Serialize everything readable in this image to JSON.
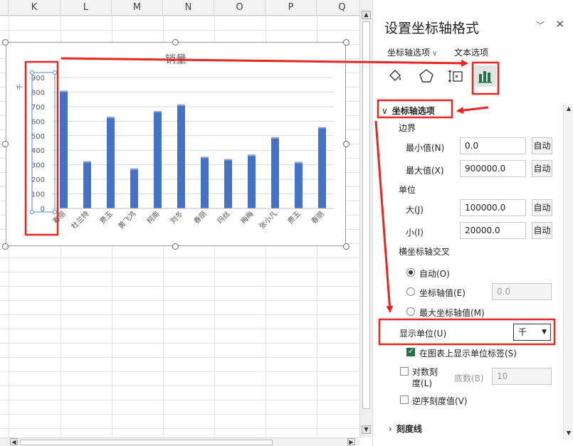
{
  "sheet": {
    "columns": [
      "K",
      "L",
      "M",
      "N",
      "O",
      "P",
      "Q"
    ]
  },
  "chart_data": {
    "type": "bar",
    "title": "销量",
    "categories": [
      "春丽",
      "杜兰特",
      "费玉",
      "黄飞鸿",
      "柯南",
      "刘冬",
      "春丽",
      "玛丝",
      "梅梅",
      "张小凡",
      "费玉",
      "春丽"
    ],
    "values": [
      810,
      325,
      630,
      275,
      670,
      715,
      355,
      340,
      370,
      490,
      320,
      560
    ],
    "yticks": [
      "900",
      "800",
      "700",
      "600",
      "500",
      "400",
      "300",
      "200",
      "100",
      "0"
    ],
    "ylim": [
      0,
      900
    ],
    "unit_label": "千",
    "grid": true,
    "color": "#4472c4"
  },
  "pane": {
    "title": "设置坐标轴格式",
    "tab_axis_options": "坐标轴选项",
    "tab_text_options": "文本选项",
    "icons": [
      "fill-line-icon",
      "effects-pentagon-icon",
      "size-properties-icon",
      "axis-options-bar-icon"
    ],
    "section_axis": "坐标轴选项",
    "bounds_label": "边界",
    "min_label": "最小值(N)",
    "min_value": "0.0",
    "max_label": "最大值(X)",
    "max_value": "900000.0",
    "auto": "自动",
    "units_label": "单位",
    "major_label": "大(J)",
    "major_value": "100000.0",
    "minor_label": "小(I)",
    "minor_value": "20000.0",
    "cross_label": "横坐标轴交叉",
    "radio_auto": "自动(O)",
    "radio_value": "坐标轴值(E)",
    "radio_value_field": "0.0",
    "radio_max": "最大坐标轴值(M)",
    "display_units_label": "显示单位(U)",
    "display_units_value": "千",
    "show_units_label": "在图表上显示单位标签(S)",
    "log_scale_line1": "对数刻",
    "log_scale_line2": "度(L)",
    "log_base_label": "底数(B)",
    "log_base_value": "10",
    "reverse_label": "逆序刻度值(V)",
    "section_ticks": "刻度线"
  },
  "colors": {
    "accent_red": "#e8251f",
    "bar_blue": "#4472c4",
    "excel_green": "#217346"
  }
}
